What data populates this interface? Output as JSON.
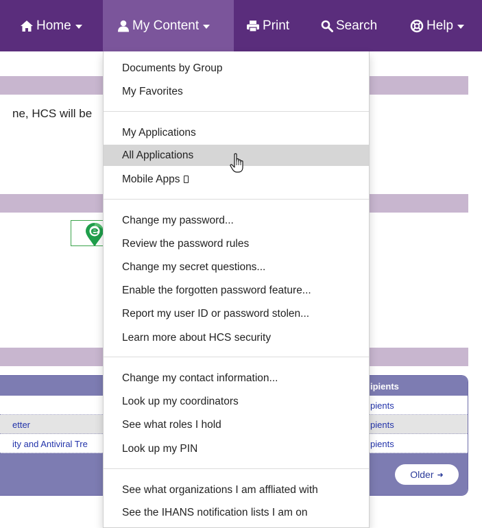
{
  "navbar": {
    "items": [
      {
        "label": "Home",
        "icon": "home-icon",
        "has_caret": true
      },
      {
        "label": "My Content",
        "icon": "user-icon",
        "has_caret": true,
        "active": true
      },
      {
        "label": "Print",
        "icon": "print-icon",
        "has_caret": false
      },
      {
        "label": "Search",
        "icon": "search-icon",
        "has_caret": false
      },
      {
        "label": "Help",
        "icon": "lifebuoy-icon",
        "has_caret": true
      }
    ]
  },
  "page": {
    "partial_text": "ne, HCS will be",
    "panel": {
      "header_right": "ipients",
      "rows": [
        {
          "left": "",
          "right": "pients"
        },
        {
          "left": "etter",
          "right": "pients"
        },
        {
          "left": "ity and Antiviral Tre",
          "right": "pients"
        }
      ],
      "older_button": "Older"
    }
  },
  "dropdown": {
    "groups": [
      [
        "Documents by Group",
        "My Favorites"
      ],
      [
        "My Applications",
        "All Applications",
        "Mobile Apps"
      ],
      [
        "Change my password...",
        "Review the password rules",
        "Change my secret questions...",
        "Enable the forgotten password feature...",
        "Report my user ID or password stolen...",
        "Learn more about HCS security"
      ],
      [
        "Change my contact information...",
        "Look up my coordinators",
        "See what roles I hold",
        "Look up my PIN"
      ],
      [
        "See what organizations I am affliated with",
        "See the IHANS notification lists I am on"
      ]
    ],
    "hovered_item": "All Applications"
  },
  "colors": {
    "navbar": "#5a2d7c",
    "navbar_active": "#7b559b",
    "section_band": "#c8b6cf",
    "panel_header": "#7d7cb2",
    "menu_hover": "#d6d6d6",
    "link": "#2233aa"
  }
}
